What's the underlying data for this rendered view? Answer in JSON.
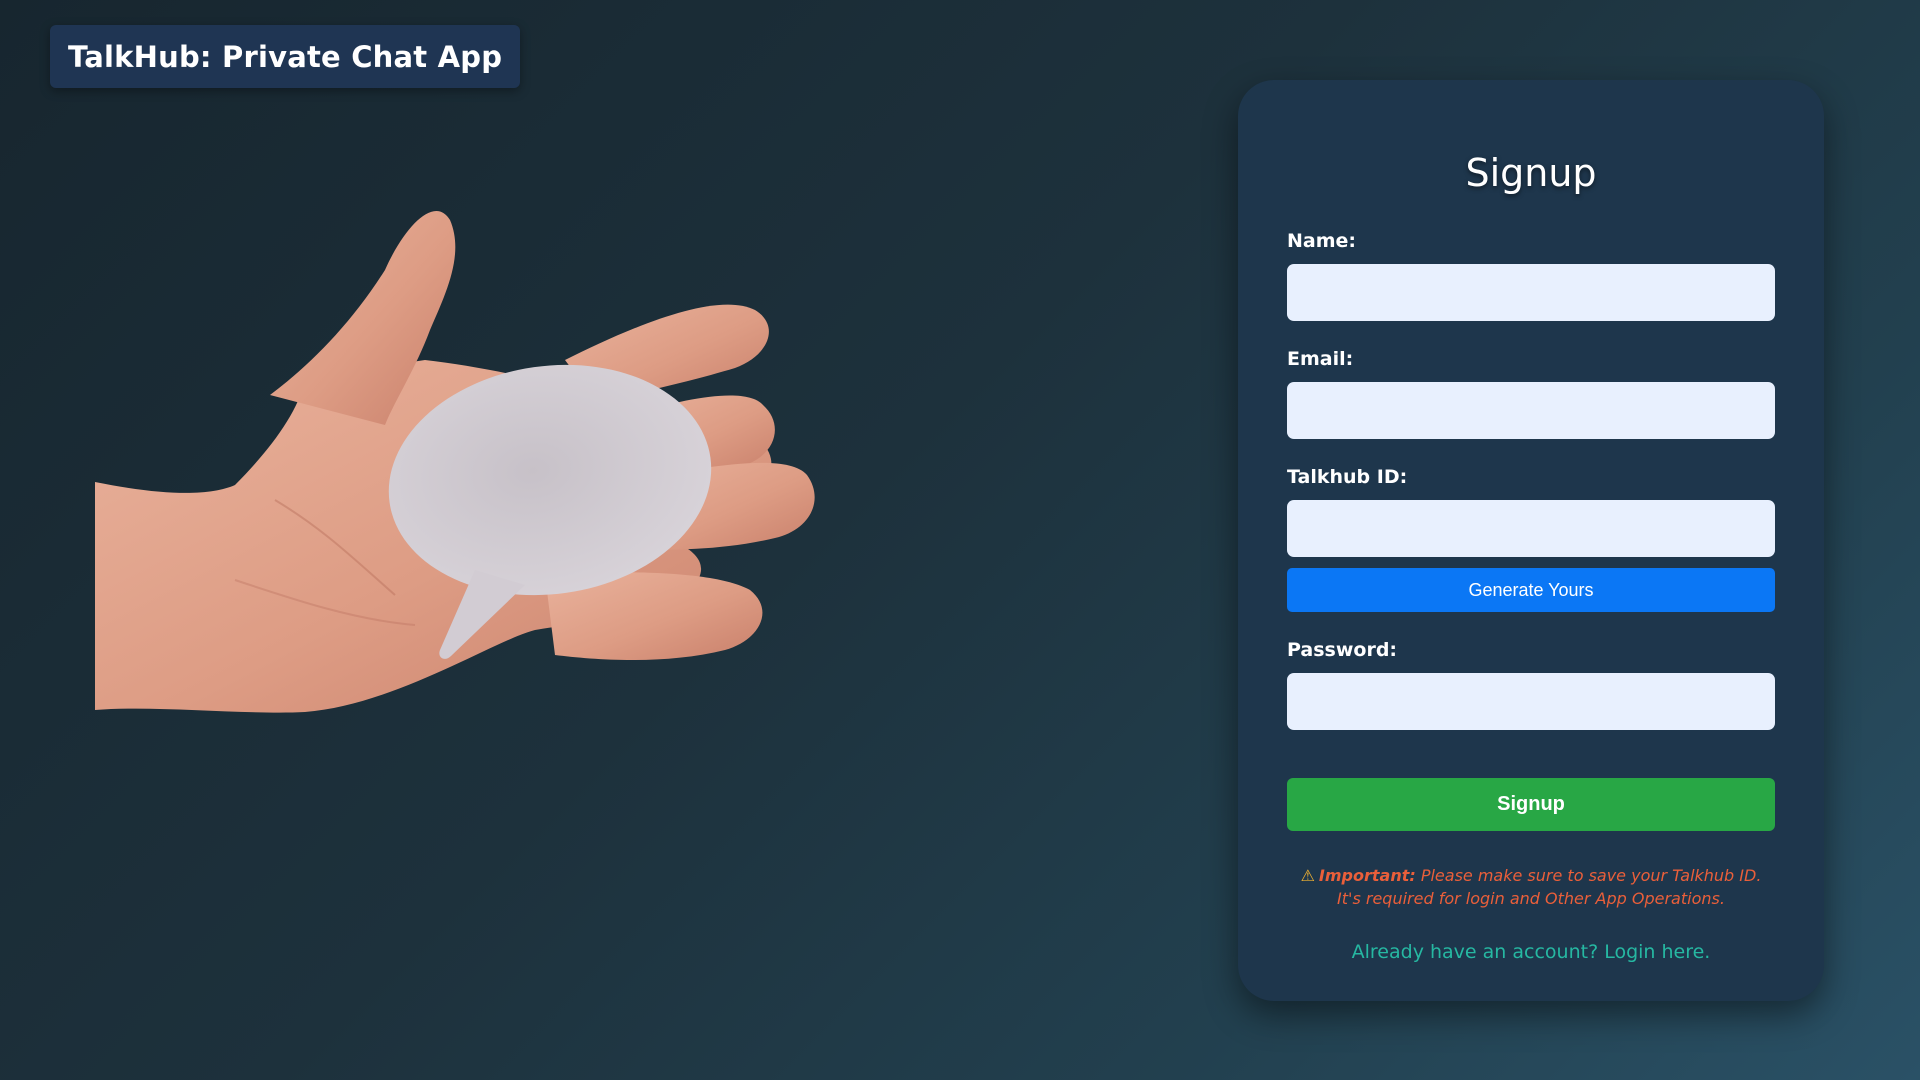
{
  "app": {
    "title": "TalkHub: Private Chat App"
  },
  "hero": {
    "image": "hand-holding-speech-bubble",
    "colors": {
      "skin": "#e0a28a",
      "bubble": "#d2ccd3"
    }
  },
  "signup_form": {
    "title": "Signup",
    "fields": {
      "name": {
        "label": "Name:",
        "value": "",
        "placeholder": ""
      },
      "email": {
        "label": "Email:",
        "value": "",
        "placeholder": ""
      },
      "talkhub_id": {
        "label": "Talkhub ID:",
        "value": "",
        "placeholder": ""
      },
      "password": {
        "label": "Password:",
        "value": "",
        "placeholder": ""
      }
    },
    "generate_button_label": "Generate Yours",
    "submit_button_label": "Signup",
    "notice": {
      "icon": "warning-icon",
      "icon_glyph": "⚠",
      "strong": "Important:",
      "text": " Please make sure to save your Talkhub ID. It's required for login and Other App Operations."
    },
    "login_link_text": "Already have an account? Login here."
  },
  "colors": {
    "card_background": "#1e364c",
    "input_background": "#e8f0fe",
    "generate_button": "#0b77f5",
    "submit_button": "#28a745",
    "notice_text": "#ea5f3a",
    "link_text": "#26b8a2"
  }
}
